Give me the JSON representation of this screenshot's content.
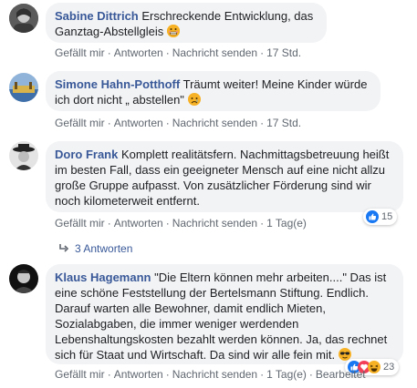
{
  "comments": [
    {
      "author": "Sabine Dittrich",
      "text": "Erschreckende Entwicklung, das Ganztag-Abstellgleis",
      "emoji": "grimacing-face-emoji",
      "actions": {
        "like": "Gefällt mir",
        "reply": "Antworten",
        "message": "Nachricht senden",
        "time": "17 Std."
      }
    },
    {
      "author": "Simone Hahn-Potthoff",
      "text": "Träumt weiter! Meine Kinder würde ich dort nicht „ abstellen\"",
      "emoji": "sad-face-emoji",
      "actions": {
        "like": "Gefällt mir",
        "reply": "Antworten",
        "message": "Nachricht senden",
        "time": "17 Std."
      }
    },
    {
      "author": "Doro Frank",
      "text": "Komplett realitätsfern. Nachmittagsbetreuung heißt im besten Fall, dass ein geeigneter Mensch auf eine nicht allzu große Gruppe aufpasst. Von zusätzlicher Förderung sind wir noch kilometerweit entfernt.",
      "actions": {
        "like": "Gefällt mir",
        "reply": "Antworten",
        "message": "Nachricht senden",
        "time": "1 Tag(e)"
      },
      "reactions": {
        "icons": [
          "like-icon"
        ],
        "count": "15"
      },
      "replies": "3 Antworten"
    },
    {
      "author": "Klaus Hagemann",
      "text": "\"Die Eltern können mehr arbeiten....\" Das ist eine schöne Feststellung der Bertelsmann Stiftung. Endlich. Darauf warten alle Bewohner, damit endlich Mieten, Sozialabgaben, die immer weniger werdenden Lebenshaltungskosten bezahlt werden können. Ja, das rechnet sich für Staat und Wirtschaft. Da sind wir alle fein mit.",
      "emoji": "sunglasses-face-emoji",
      "actions": {
        "like": "Gefällt mir",
        "reply": "Antworten",
        "message": "Nachricht senden",
        "time": "1 Tag(e)",
        "edited": "Bearbeitet"
      },
      "reactions": {
        "icons": [
          "like-icon",
          "love-icon",
          "haha-icon"
        ],
        "count": "23"
      }
    }
  ],
  "colors": {
    "author": "#385898",
    "bubble": "#f2f3f5",
    "meta": "#606770",
    "like": "#1877f2",
    "love": "#f33e58",
    "haha": "#f7b125"
  }
}
